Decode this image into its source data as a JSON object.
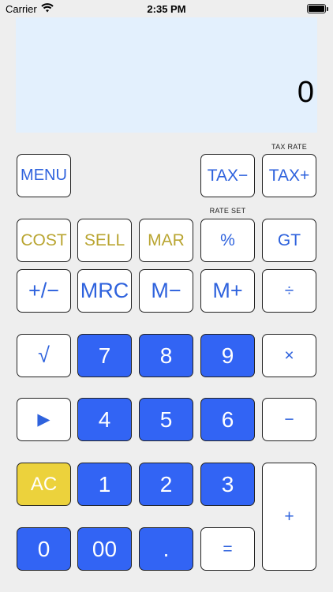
{
  "status_bar": {
    "carrier": "Carrier",
    "time": "2:35 PM"
  },
  "display": {
    "value": "0"
  },
  "captions": {
    "tax_rate": "TAX RATE",
    "rate_set": "RATE SET"
  },
  "keys": {
    "menu": "MENU",
    "tax_minus": "TAX−",
    "tax_plus": "TAX+",
    "cost": "COST",
    "sell": "SELL",
    "mar": "MAR",
    "percent": "%",
    "gt": "GT",
    "plus_minus": "+/−",
    "mrc": "MRC",
    "m_minus": "M−",
    "m_plus": "M+",
    "divide": "÷",
    "sqrt": "√",
    "seven": "7",
    "eight": "8",
    "nine": "9",
    "multiply": "×",
    "play": "▶",
    "four": "4",
    "five": "5",
    "six": "6",
    "minus": "−",
    "ac": "AC",
    "one": "1",
    "two": "2",
    "three": "3",
    "plus": "+",
    "zero": "0",
    "double_zero": "00",
    "decimal": ".",
    "equals": "="
  },
  "colors": {
    "background": "#eeeeee",
    "display": "#e3f0fd",
    "key_text_blue": "#2e62dd",
    "key_text_gold": "#b9a531",
    "digit_key_fill": "#3264f4",
    "ac_key_fill": "#ecd23c"
  },
  "icons": {
    "wifi": "wifi-icon",
    "battery": "battery-icon"
  }
}
